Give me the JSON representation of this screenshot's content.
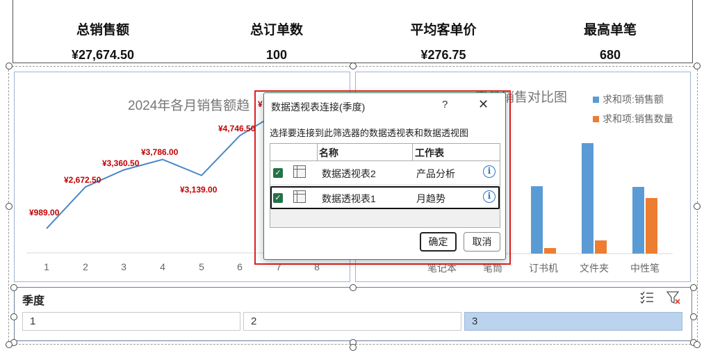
{
  "kpis": [
    {
      "label": "总销售额",
      "value": "¥27,674.50"
    },
    {
      "label": "总订单数",
      "value": "100"
    },
    {
      "label": "平均客单价",
      "value": "¥276.75"
    },
    {
      "label": "最高单笔",
      "value": "680"
    }
  ],
  "chart_data": [
    {
      "type": "line",
      "title": "2024年各月销售额趋",
      "x": [
        "1",
        "2",
        "3",
        "4",
        "5",
        "6",
        "7",
        "8"
      ],
      "series": [
        {
          "values": [
            989.0,
            2672.5,
            3360.5,
            3786.0,
            3139.0,
            4746.5,
            null,
            null
          ]
        }
      ],
      "data_labels": [
        "¥989.00",
        "¥2,672.50",
        "¥3,360.50",
        "¥3,786.00",
        "¥3,139.00",
        "¥4,746.50",
        "¥"
      ],
      "line_color": "#4a86c5",
      "label_color": "#c00000"
    },
    {
      "type": "bar",
      "title": "产品销售对比图",
      "categories": [
        "笔记本",
        "笔筒",
        "订书机",
        "文件夹",
        "中性笔"
      ],
      "series": [
        {
          "name": "求和项:销售额",
          "color": "#5b9bd5",
          "values": [
            null,
            null,
            97,
            159,
            96
          ]
        },
        {
          "name": "求和项:销售数量",
          "color": "#ed7d31",
          "values": [
            null,
            null,
            8,
            19,
            80
          ]
        }
      ],
      "legend": "top-right"
    }
  ],
  "dialog": {
    "title": "数据透视表连接(季度)",
    "help": "?",
    "close": "✕",
    "description": "选择要连接到此筛选器的数据透视表和数据透视图",
    "col_name": "名称",
    "col_sheet": "工作表",
    "rows": [
      {
        "name": "数据透视表2",
        "sheet": "产品分析",
        "checked": true
      },
      {
        "name": "数据透视表1",
        "sheet": "月趋势",
        "checked": true
      }
    ],
    "ok": "确定",
    "cancel": "取消"
  },
  "slicer": {
    "title": "季度",
    "items": [
      {
        "label": "1",
        "selected": false
      },
      {
        "label": "2",
        "selected": false
      },
      {
        "label": "3",
        "selected": true
      }
    ],
    "icons": [
      "multi-select-icon",
      "clear-filter-icon"
    ]
  }
}
